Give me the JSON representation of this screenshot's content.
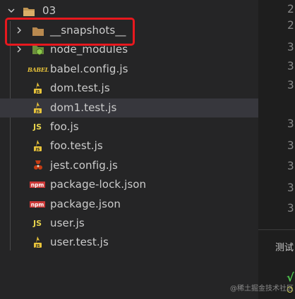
{
  "explorer": {
    "folder": {
      "label": "03",
      "icon": "folder-open-icon",
      "expanded": true
    },
    "items": [
      {
        "label": "__snapshots__",
        "icon": "folder-icon",
        "collapsed": true,
        "highlighted": true
      },
      {
        "label": "node_modules",
        "icon": "nodejs-folder-icon",
        "collapsed": true
      },
      {
        "label": "babel.config.js",
        "icon": "babel-icon",
        "icon_text": "BABEL"
      },
      {
        "label": "dom.test.js",
        "icon": "jest-test-icon"
      },
      {
        "label": "dom1.test.js",
        "icon": "jest-test-icon",
        "selected": true
      },
      {
        "label": "foo.js",
        "icon": "js-icon",
        "icon_text": "JS"
      },
      {
        "label": "foo.test.js",
        "icon": "jest-test-icon"
      },
      {
        "label": "jest.config.js",
        "icon": "jest-config-icon"
      },
      {
        "label": "package-lock.json",
        "icon": "npm-icon",
        "icon_text": "npm"
      },
      {
        "label": "package.json",
        "icon": "npm-icon",
        "icon_text": "npm"
      },
      {
        "label": "user.js",
        "icon": "js-icon",
        "icon_text": "JS"
      },
      {
        "label": "user.test.js",
        "icon": "jest-test-icon"
      }
    ]
  },
  "editor": {
    "line_numbers": [
      "2",
      "2",
      "3",
      "3",
      "3",
      "3",
      "3",
      "3",
      "3",
      "3"
    ]
  },
  "panel": {
    "title": "测试",
    "status_mark": "√",
    "status_char": "O"
  },
  "watermark": "@稀土掘金技术社区",
  "colors": {
    "background": "#252526",
    "editor_background": "#1e1e1e",
    "selected_row": "#37373d",
    "highlight_border": "#e8181e",
    "folder": "#c09553",
    "js": "#e8d44d",
    "npm": "#cb3837",
    "node": "#8cc84b"
  }
}
